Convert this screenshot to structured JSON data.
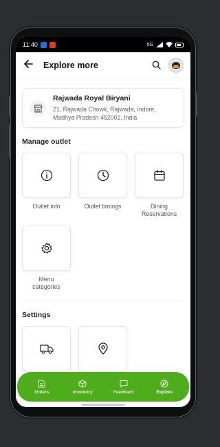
{
  "statusbar": {
    "time": "11:40",
    "network": "5G",
    "battery_icon": "battery-icon"
  },
  "header": {
    "title": "Explore more",
    "back_icon": "back-arrow-icon",
    "search_icon": "search-icon"
  },
  "outlet": {
    "name": "Rajwada Royal Biryani",
    "address_line1": "21, Rajwada Chowk, Rajwada, Indore,",
    "address_line2": "Madhya Pradesh 452002, India"
  },
  "manage_outlet": {
    "title": "Manage outlet",
    "tiles": [
      {
        "label": "Outlet info",
        "icon": "info-icon"
      },
      {
        "label": "Outlet timings",
        "icon": "clock-icon"
      },
      {
        "label_line1": "Dining",
        "label_line2": "Reservations",
        "icon": "calendar-icon"
      },
      {
        "label_line1": "Menu",
        "label_line2": "categories",
        "icon": "gear-icon"
      }
    ]
  },
  "settings": {
    "title": "Settings",
    "tiles": [
      {
        "icon": "truck-icon"
      },
      {
        "icon": "location-pin-icon"
      }
    ]
  },
  "bottom_nav": {
    "items": [
      {
        "label": "Orders",
        "icon": "document-icon"
      },
      {
        "label": "Inventory",
        "icon": "box-icon"
      },
      {
        "label": "Feedback",
        "icon": "chat-icon"
      },
      {
        "label": "Explore",
        "icon": "compass-icon",
        "active": true
      }
    ]
  },
  "colors": {
    "accent": "#4fad1d",
    "background": "#2b2d31"
  }
}
